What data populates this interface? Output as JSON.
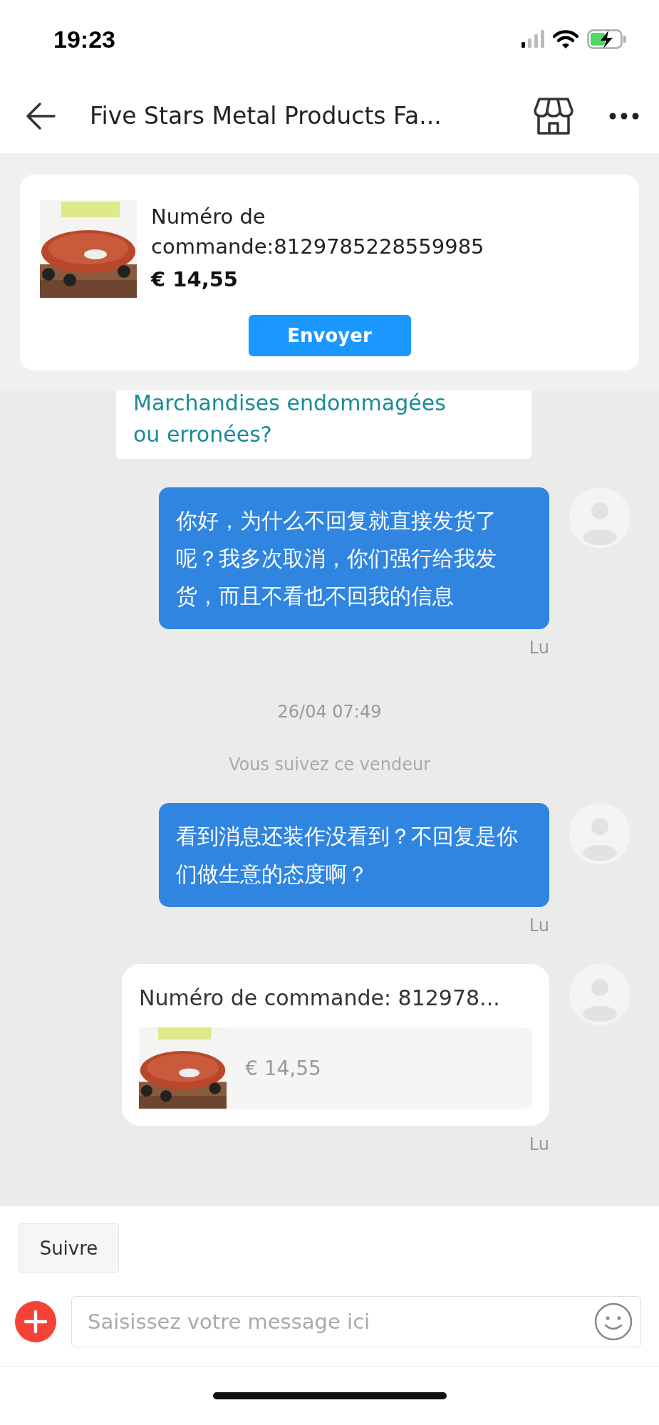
{
  "status_bar": {
    "time": "19:23"
  },
  "header": {
    "title": "Five Stars Metal Products Fa..."
  },
  "pinned_order": {
    "kind": "picture",
    "label": "Numéro de commande:8129785228559985",
    "price": "€ 14,55",
    "button": "Envoyer"
  },
  "messages": [
    {
      "kind": "option",
      "text": "Marchandises endommagées ou erronées?"
    },
    {
      "kind": "text",
      "text": "你好，为什么不回复就直接发货了呢？我多次取消，你们强行给我发货，而且不看也不回我的信息",
      "status": "Lu"
    },
    {
      "kind": "timestamp",
      "text": "26/04 07:49"
    },
    {
      "kind": "notice",
      "text": "Vous suivez ce vendeur"
    },
    {
      "kind": "text",
      "text": "看到消息还装作没看到？不回复是你们做生意的态度啊？",
      "status": "Lu"
    },
    {
      "kind": "order",
      "title": "Numéro de commande: 812978...",
      "price": "€ 14,55",
      "status": "Lu"
    }
  ],
  "follow_button": "Suivre",
  "composer": {
    "placeholder": "Saisissez votre message ici"
  }
}
